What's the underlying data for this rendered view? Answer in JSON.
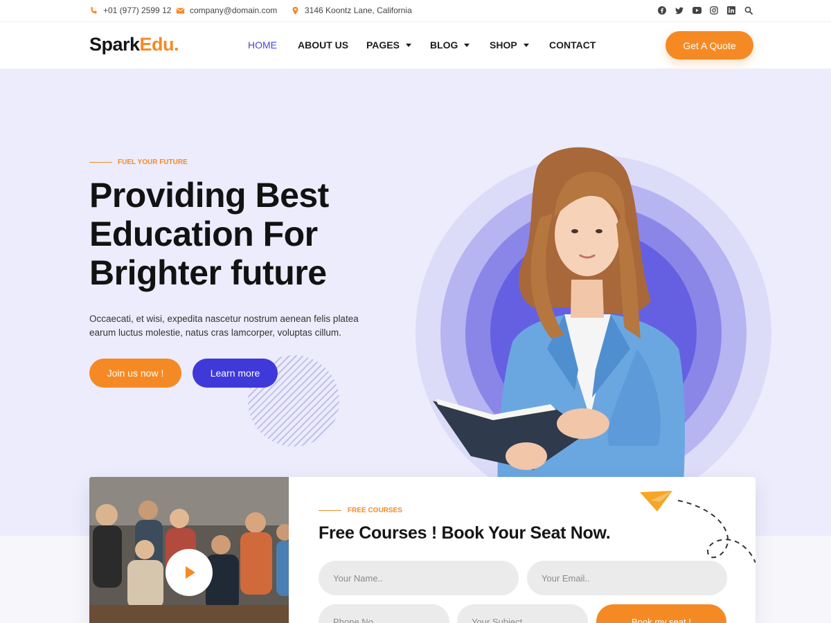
{
  "topbar": {
    "phone": "+01 (977) 2599 12",
    "email": "company@domain.com",
    "address": "3146 Koontz Lane, California",
    "social_icons": [
      "facebook-icon",
      "twitter-icon",
      "youtube-icon",
      "instagram-icon",
      "linkedin-icon",
      "search-icon"
    ]
  },
  "nav": {
    "logo_part1": "Spark",
    "logo_part2": "Edu.",
    "items": [
      {
        "label": "HOME",
        "active": true,
        "dropdown": false
      },
      {
        "label": "ABOUT US",
        "active": false,
        "dropdown": false
      },
      {
        "label": "PAGES",
        "active": false,
        "dropdown": true
      },
      {
        "label": "BLOG",
        "active": false,
        "dropdown": true
      },
      {
        "label": "SHOP",
        "active": false,
        "dropdown": true
      },
      {
        "label": "CONTACT",
        "active": false,
        "dropdown": false
      }
    ],
    "cta": "Get A Quote"
  },
  "hero": {
    "eyebrow": "FUEL YOUR FUTURE",
    "headline_line1": "Providing Best",
    "headline_line2": "Education For",
    "headline_line3": "Brighter future",
    "description": "Occaecati, et wisi, expedita nascetur nostrum aenean felis platea earum luctus molestie, natus cras lamcorper, voluptas cillum.",
    "primary_button": "Join us now !",
    "secondary_button": "Learn more"
  },
  "booking": {
    "eyebrow": "FREE COURSES",
    "title": "Free Courses ! Book Your Seat Now.",
    "fields": {
      "name_placeholder": "Your Name..",
      "email_placeholder": "Your Email..",
      "phone_placeholder": "Phone No..",
      "subject_placeholder": "Your Subject.."
    },
    "submit": "Book my seat !"
  },
  "colors": {
    "accent_orange": "#f58a24",
    "accent_blue": "#4039d9",
    "hero_bg": "#ececfc"
  }
}
